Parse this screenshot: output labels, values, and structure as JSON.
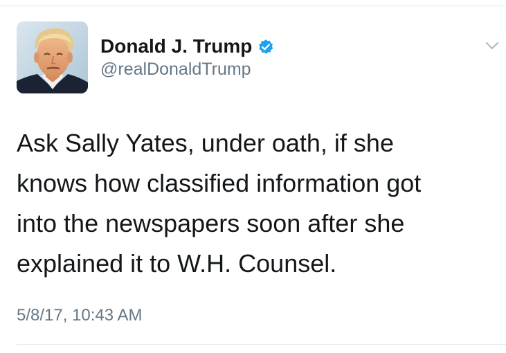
{
  "tweet": {
    "author": {
      "display_name": "Donald J. Trump",
      "handle": "@realDonaldTrump",
      "verified": true
    },
    "text_lines": [
      "Ask Sally Yates, under oath, if she",
      "knows how classified information got",
      "into the newspapers soon after she",
      "explained it to W.H. Counsel."
    ],
    "timestamp": "5/8/17, 10:43 AM"
  },
  "icons": {
    "verified": "verified-badge-icon",
    "menu": "chevron-down-icon"
  },
  "colors": {
    "primary_text": "#14171a",
    "secondary_text": "#657786",
    "verified_blue": "#1da1f2",
    "divider": "#e1e8ed"
  }
}
